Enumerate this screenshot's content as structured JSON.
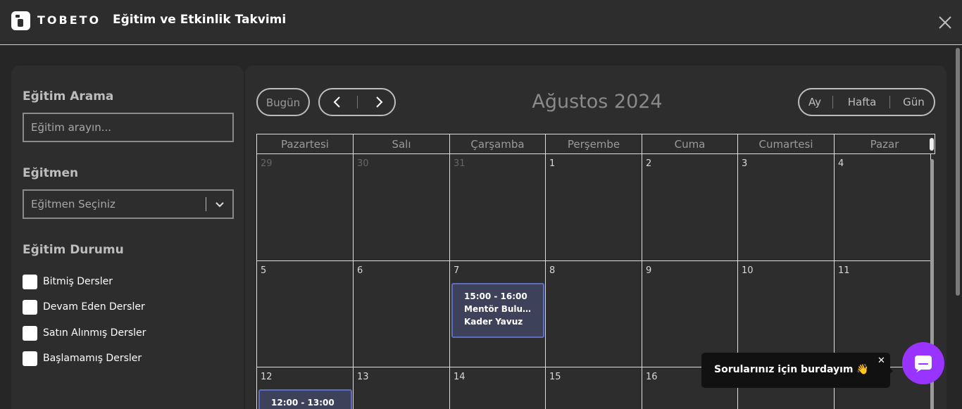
{
  "header": {
    "brand": "TOBETO",
    "title": "Eğitim ve Etkinlik Takvimi"
  },
  "filters": {
    "search_label": "Eğitim Arama",
    "search_placeholder": "Eğitim arayın...",
    "instructor_label": "Eğitmen",
    "instructor_placeholder": "Eğitmen Seçiniz",
    "status_label": "Eğitim Durumu",
    "status_options": [
      "Bitmiş Dersler",
      "Devam Eden Dersler",
      "Satın Alınmış Dersler",
      "Başlamamış Dersler"
    ]
  },
  "calendar": {
    "today_label": "Bugün",
    "month_title": "Ağustos 2024",
    "views": [
      "Ay",
      "Hafta",
      "Gün"
    ],
    "weekdays": [
      "Pazartesi",
      "Salı",
      "Çarşamba",
      "Perşembe",
      "Cuma",
      "Cumartesi",
      "Pazar"
    ],
    "weeks": [
      [
        "29",
        "30",
        "31",
        "1",
        "2",
        "3",
        "4"
      ],
      [
        "5",
        "6",
        "7",
        "8",
        "9",
        "10",
        "11"
      ],
      [
        "12",
        "13",
        "14",
        "15",
        "16",
        "",
        ""
      ]
    ],
    "events": [
      {
        "time": "15:00 - 16:00",
        "title": "Mentör Buluşması",
        "person": "Kader Yavuz"
      },
      {
        "time": "12:00 - 13:00"
      }
    ]
  },
  "chat": {
    "tooltip": "Sorularınız için burdayım 👋",
    "close": "✕"
  },
  "colors": {
    "accent": "#9933ff",
    "event_bg": "#3d425a",
    "event_border": "#5b6fc2"
  }
}
